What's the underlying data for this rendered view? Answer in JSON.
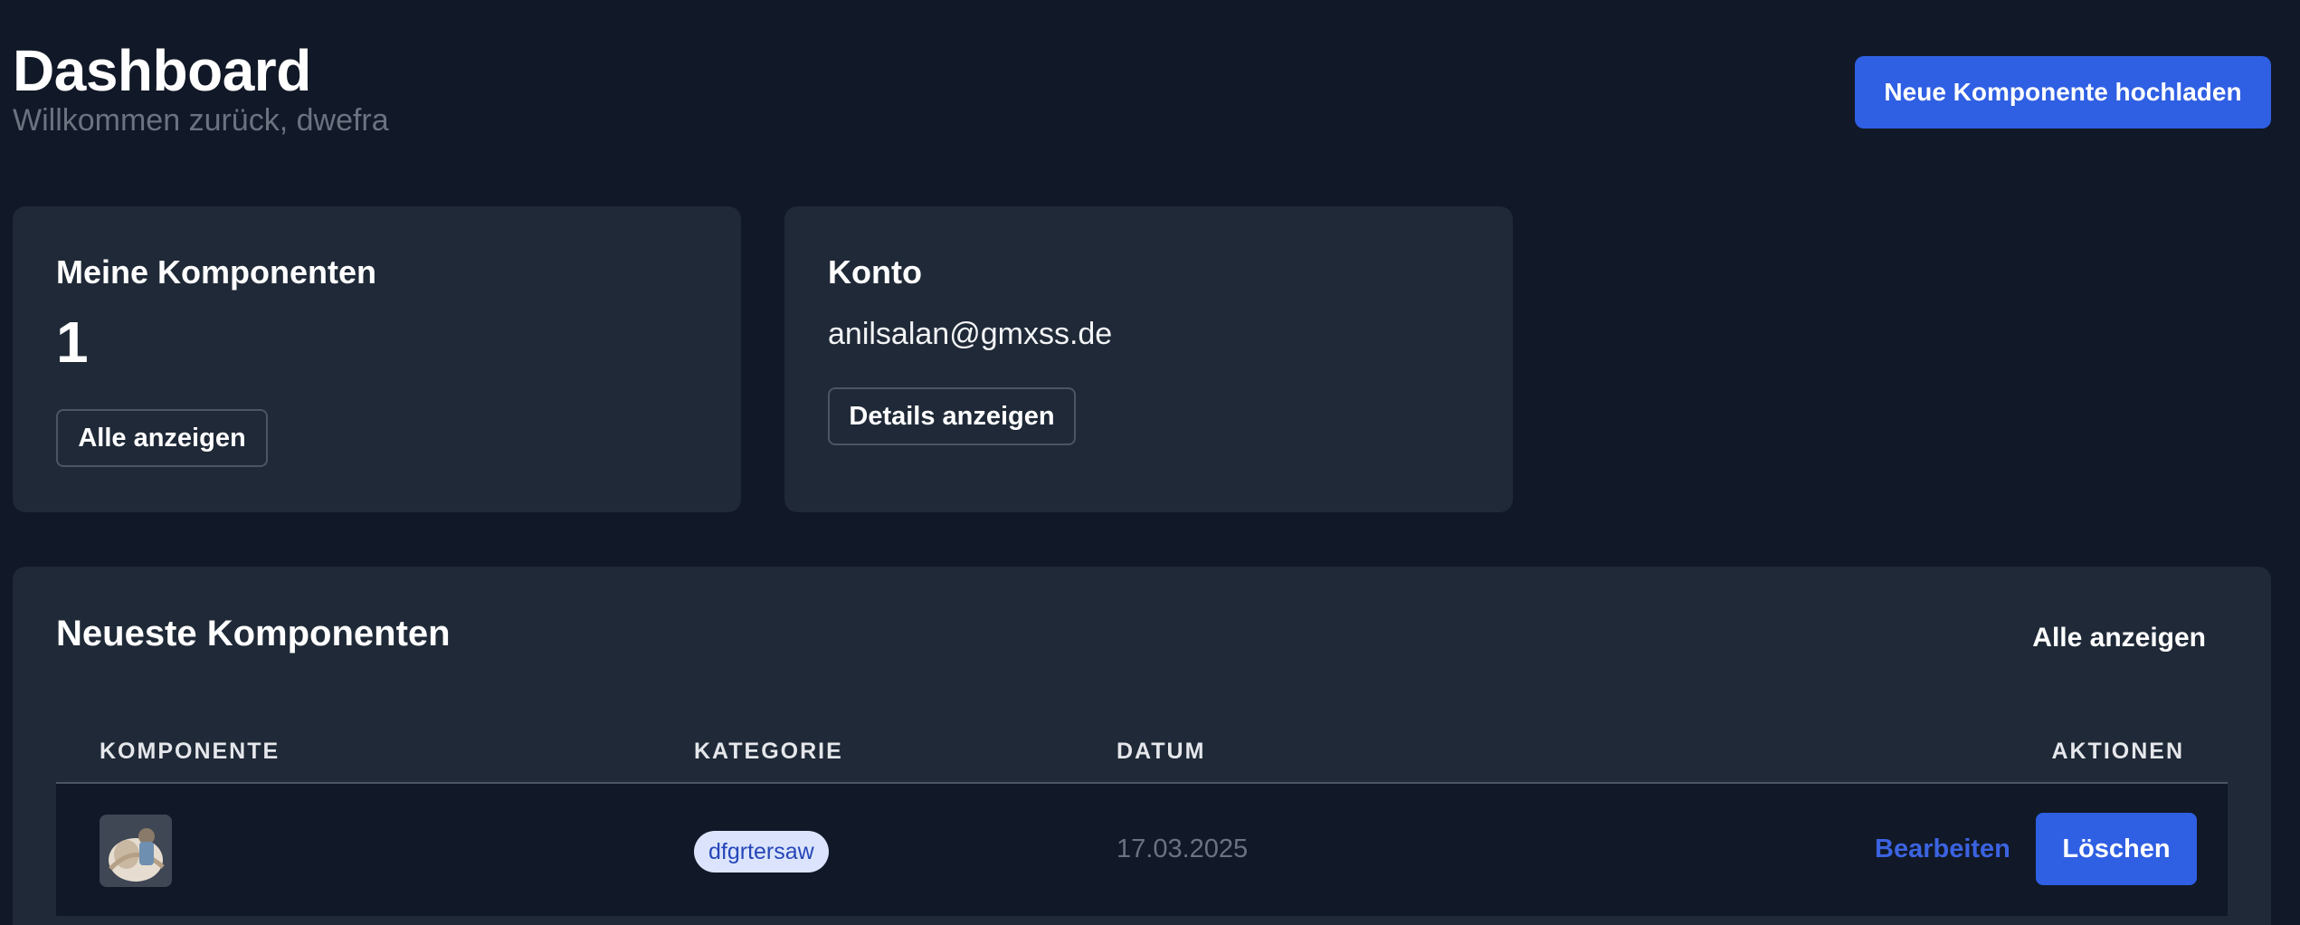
{
  "header": {
    "title": "Dashboard",
    "subtitle": "Willkommen zurück, dwefra",
    "upload_label": "Neue Komponente hochladen"
  },
  "cards": {
    "components": {
      "title": "Meine Komponenten",
      "count": "1",
      "button_label": "Alle anzeigen"
    },
    "account": {
      "title": "Konto",
      "email": "anilsalan@gmxss.de",
      "button_label": "Details anzeigen"
    }
  },
  "recent": {
    "title": "Neueste Komponenten",
    "view_all_label": "Alle anzeigen",
    "columns": [
      "KOMPONENTE",
      "KATEGORIE",
      "DATUM",
      "AKTIONEN"
    ],
    "rows": [
      {
        "category": "dfgrtersaw",
        "date": "17.03.2025",
        "edit_label": "Bearbeiten",
        "delete_label": "Löschen"
      }
    ]
  },
  "colors": {
    "background": "#111827",
    "card": "#1f2937",
    "accent": "#2f5fe3",
    "muted_text": "#6b7280",
    "badge_bg": "#dbe4fc",
    "badge_text": "#2546b8"
  }
}
